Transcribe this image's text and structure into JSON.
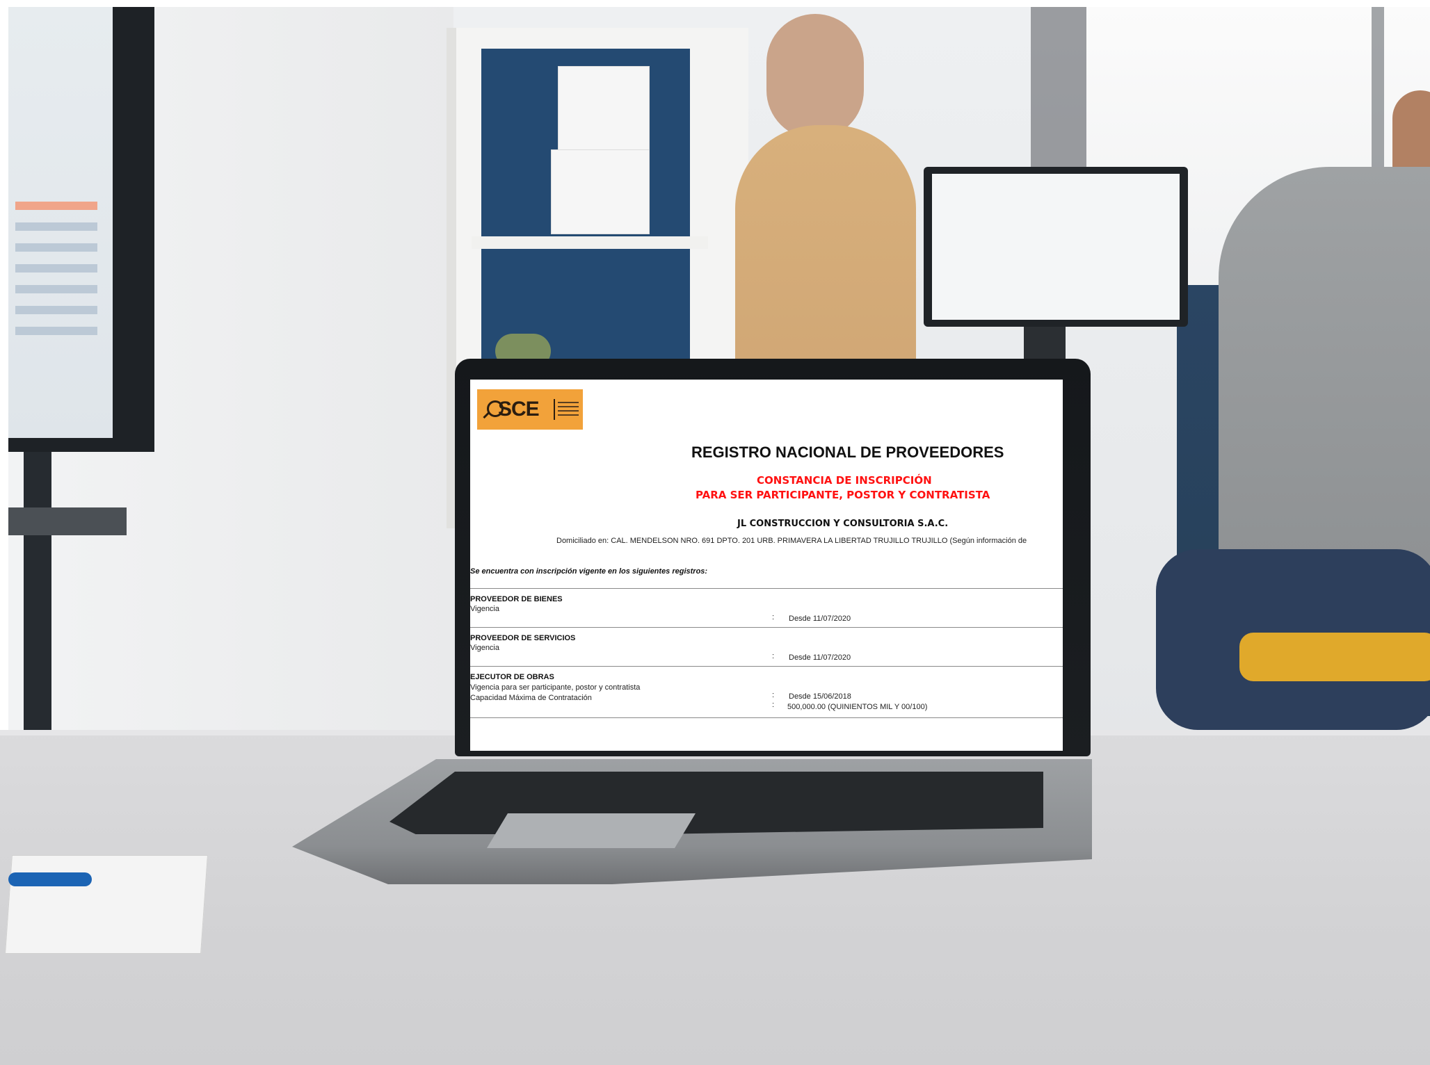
{
  "document": {
    "logo_text": "SCE",
    "main_title": "REGISTRO NACIONAL DE PROVEEDORES",
    "subtitle_line1": "CONSTANCIA DE INSCRIPCIÓN",
    "subtitle_line2": "PARA SER PARTICIPANTE, POSTOR Y CONTRATISTA",
    "company": "JL CONSTRUCCION Y CONSULTORIA S.A.C.",
    "address": "Domiciliado en: CAL. MENDELSON NRO. 691 DPTO. 201 URB. PRIMAVERA LA LIBERTAD TRUJILLO TRUJILLO (Según información de",
    "intro": "Se encuentra con inscripción vigente en los siguientes registros:",
    "registries": [
      {
        "name": "PROVEEDOR DE BIENES",
        "rows": [
          {
            "label": "Vigencia",
            "value": "Desde  11/07/2020"
          }
        ]
      },
      {
        "name": "PROVEEDOR DE SERVICIOS",
        "rows": [
          {
            "label": "Vigencia",
            "value": "Desde  11/07/2020"
          }
        ]
      },
      {
        "name": "EJECUTOR DE OBRAS",
        "rows": [
          {
            "label": "Vigencia para ser participante, postor y contratista",
            "value": "Desde  15/06/2018"
          },
          {
            "label": "Capacidad Máxima de Contratación",
            "value": "500,000.00 (QUINIENTOS MIL Y 00/100)"
          }
        ]
      }
    ],
    "separator": ":"
  },
  "colors": {
    "logo_orange": "#f2a23a",
    "title_red": "#ff1111",
    "laptop_bezel": "#15181b"
  }
}
